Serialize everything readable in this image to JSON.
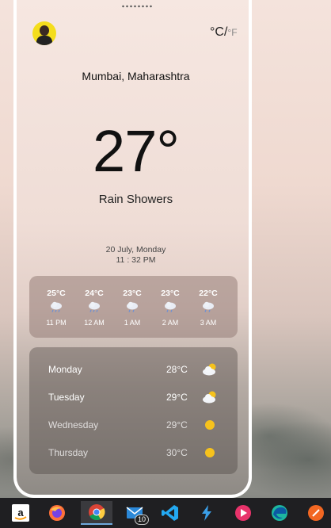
{
  "header": {
    "unit_celsius": "°C",
    "unit_sep": "/",
    "unit_fahrenheit": "°F"
  },
  "location": "Mumbai, Maharashtra",
  "current": {
    "temperature": "27°",
    "condition": "Rain Showers",
    "date": "20 July, Monday",
    "time": "11 : 32 PM"
  },
  "hourly": [
    {
      "temp": "25°C",
      "time": "11 PM",
      "icon": "rain-cloud-icon"
    },
    {
      "temp": "24°C",
      "time": "12 AM",
      "icon": "rain-cloud-icon"
    },
    {
      "temp": "23°C",
      "time": "1 AM",
      "icon": "rain-cloud-icon"
    },
    {
      "temp": "23°C",
      "time": "2 AM",
      "icon": "rain-cloud-icon"
    },
    {
      "temp": "22°C",
      "time": "3 AM",
      "icon": "rain-cloud-icon"
    }
  ],
  "daily": [
    {
      "day": "Monday",
      "temp": "28°C",
      "icon": "cloud-sun-icon"
    },
    {
      "day": "Tuesday",
      "temp": "29°C",
      "icon": "cloud-sun-icon"
    },
    {
      "day": "Wednesday",
      "temp": "29°C",
      "icon": "sun-icon"
    },
    {
      "day": "Thursday",
      "temp": "30°C",
      "icon": "sun-icon"
    }
  ],
  "taskbar": {
    "apps": [
      "amazon",
      "firefox",
      "chrome",
      "mail",
      "vscode",
      "app",
      "media-player",
      "edge",
      "app"
    ],
    "mail_badge": "10"
  }
}
